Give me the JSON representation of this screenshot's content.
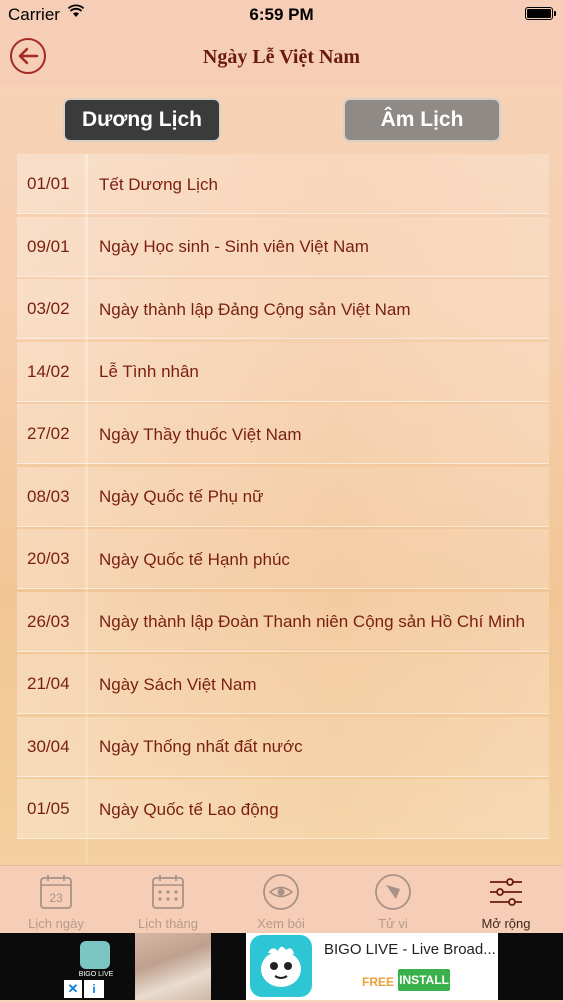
{
  "status_bar": {
    "carrier": "Carrier",
    "time": "6:59 PM",
    "wifi_icon": "wifi-icon",
    "battery_icon": "battery-icon"
  },
  "header": {
    "title": "Ngày Lễ Việt Nam",
    "back_icon": "back-arrow-icon"
  },
  "segments": {
    "solar": "Dương Lịch",
    "lunar": "Âm Lịch",
    "selected": "solar"
  },
  "holidays": [
    {
      "date": "01/01",
      "name": "Tết Dương Lịch"
    },
    {
      "date": "09/01",
      "name": "Ngày Học sinh - Sinh viên Việt Nam"
    },
    {
      "date": "03/02",
      "name": "Ngày thành lập Đảng Cộng sản Việt Nam"
    },
    {
      "date": "14/02",
      "name": "Lễ Tình nhân"
    },
    {
      "date": "27/02",
      "name": "Ngày Thầy thuốc Việt Nam"
    },
    {
      "date": "08/03",
      "name": "Ngày Quốc tế Phụ nữ"
    },
    {
      "date": "20/03",
      "name": "Ngày Quốc tế Hạnh phúc"
    },
    {
      "date": "26/03",
      "name": "Ngày thành lập Đoàn Thanh niên Cộng sản Hồ Chí Minh"
    },
    {
      "date": "21/04",
      "name": "Ngày Sách Việt Nam"
    },
    {
      "date": "30/04",
      "name": "Ngày Thống nhất đất nước"
    },
    {
      "date": "01/05",
      "name": "Ngày Quốc tế Lao động"
    }
  ],
  "tabs": [
    {
      "label": "Lịch ngày",
      "icon": "calendar-day-icon",
      "icon_text": "23"
    },
    {
      "label": "Lịch tháng",
      "icon": "calendar-month-icon"
    },
    {
      "label": "Xem bói",
      "icon": "eye-icon"
    },
    {
      "label": "Tử vi",
      "icon": "compass-icon"
    },
    {
      "label": "Mở rộng",
      "icon": "sliders-icon",
      "selected": true
    }
  ],
  "ad": {
    "small_logo_label": "BIGO LIVE",
    "app_name": "BIGO LIVE - Live Broad...",
    "free_label": "FREE",
    "install_label": "INSTALL",
    "close_label": "✕",
    "info_label": "i"
  },
  "colors": {
    "accent": "#a32b22",
    "text": "#7a1f10",
    "header_bg": "#f6cdb6"
  }
}
